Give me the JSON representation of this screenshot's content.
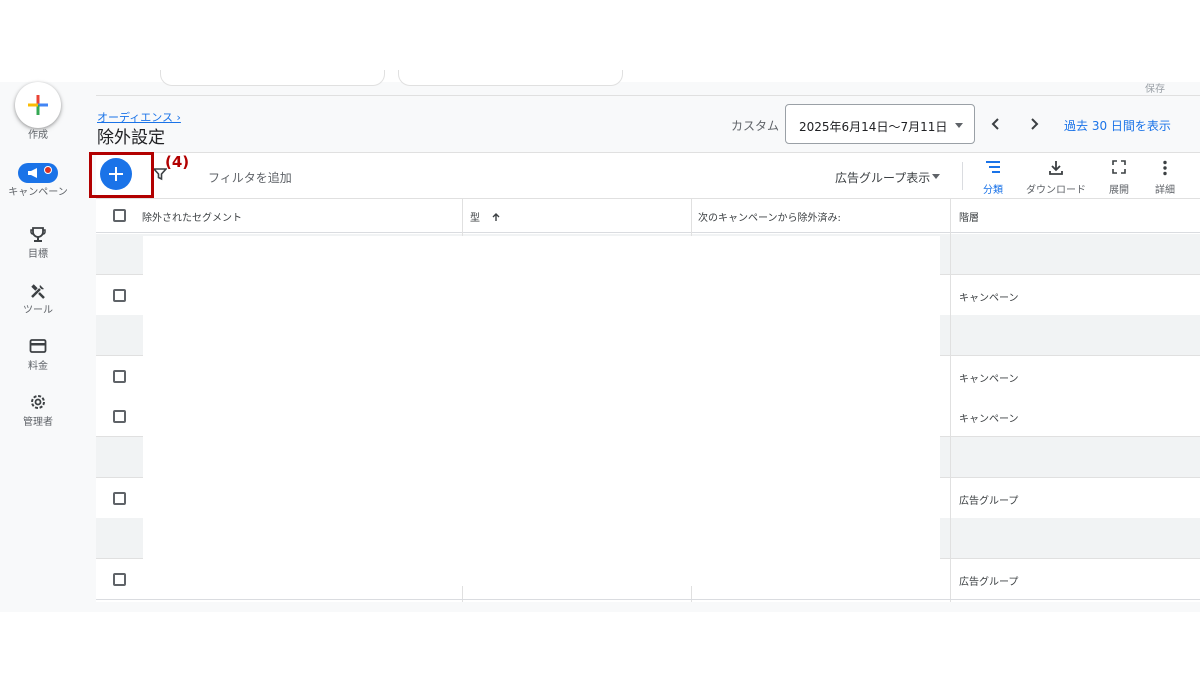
{
  "nav": {
    "create": "作成",
    "campaigns": "キャンペーン",
    "goals": "目標",
    "tools": "ツール",
    "billing": "料金",
    "admin": "管理者"
  },
  "header": {
    "save": "保存",
    "breadcrumb": "オーディエンス ›",
    "title": "除外設定",
    "custom_label": "カスタム",
    "date_range": "2025年6月14日〜7月11日",
    "show_last_30": "過去 30 日間を表示"
  },
  "toolbar": {
    "annotation": "(4)",
    "add_filter": "フィルタを追加",
    "adgroup_view": "広告グループ表示",
    "segment": "分類",
    "download": "ダウンロード",
    "expand": "展開",
    "more": "詳細"
  },
  "table": {
    "columns": [
      "除外されたセグメント",
      "型",
      "次のキャンペーンから除外済み:",
      "階層"
    ],
    "rows": [
      {
        "level": "",
        "grey": true
      },
      {
        "level": "キャンペーン",
        "grey": false
      },
      {
        "level": "",
        "grey": true
      },
      {
        "level": "キャンペーン",
        "grey": false
      },
      {
        "level": "キャンペーン",
        "grey": false
      },
      {
        "level": "",
        "grey": true
      },
      {
        "level": "広告グループ",
        "grey": false
      },
      {
        "level": "",
        "grey": true
      },
      {
        "level": "広告グループ",
        "grey": false
      }
    ]
  },
  "colors": {
    "accent": "#1a73e8",
    "annotation": "#b20000"
  }
}
